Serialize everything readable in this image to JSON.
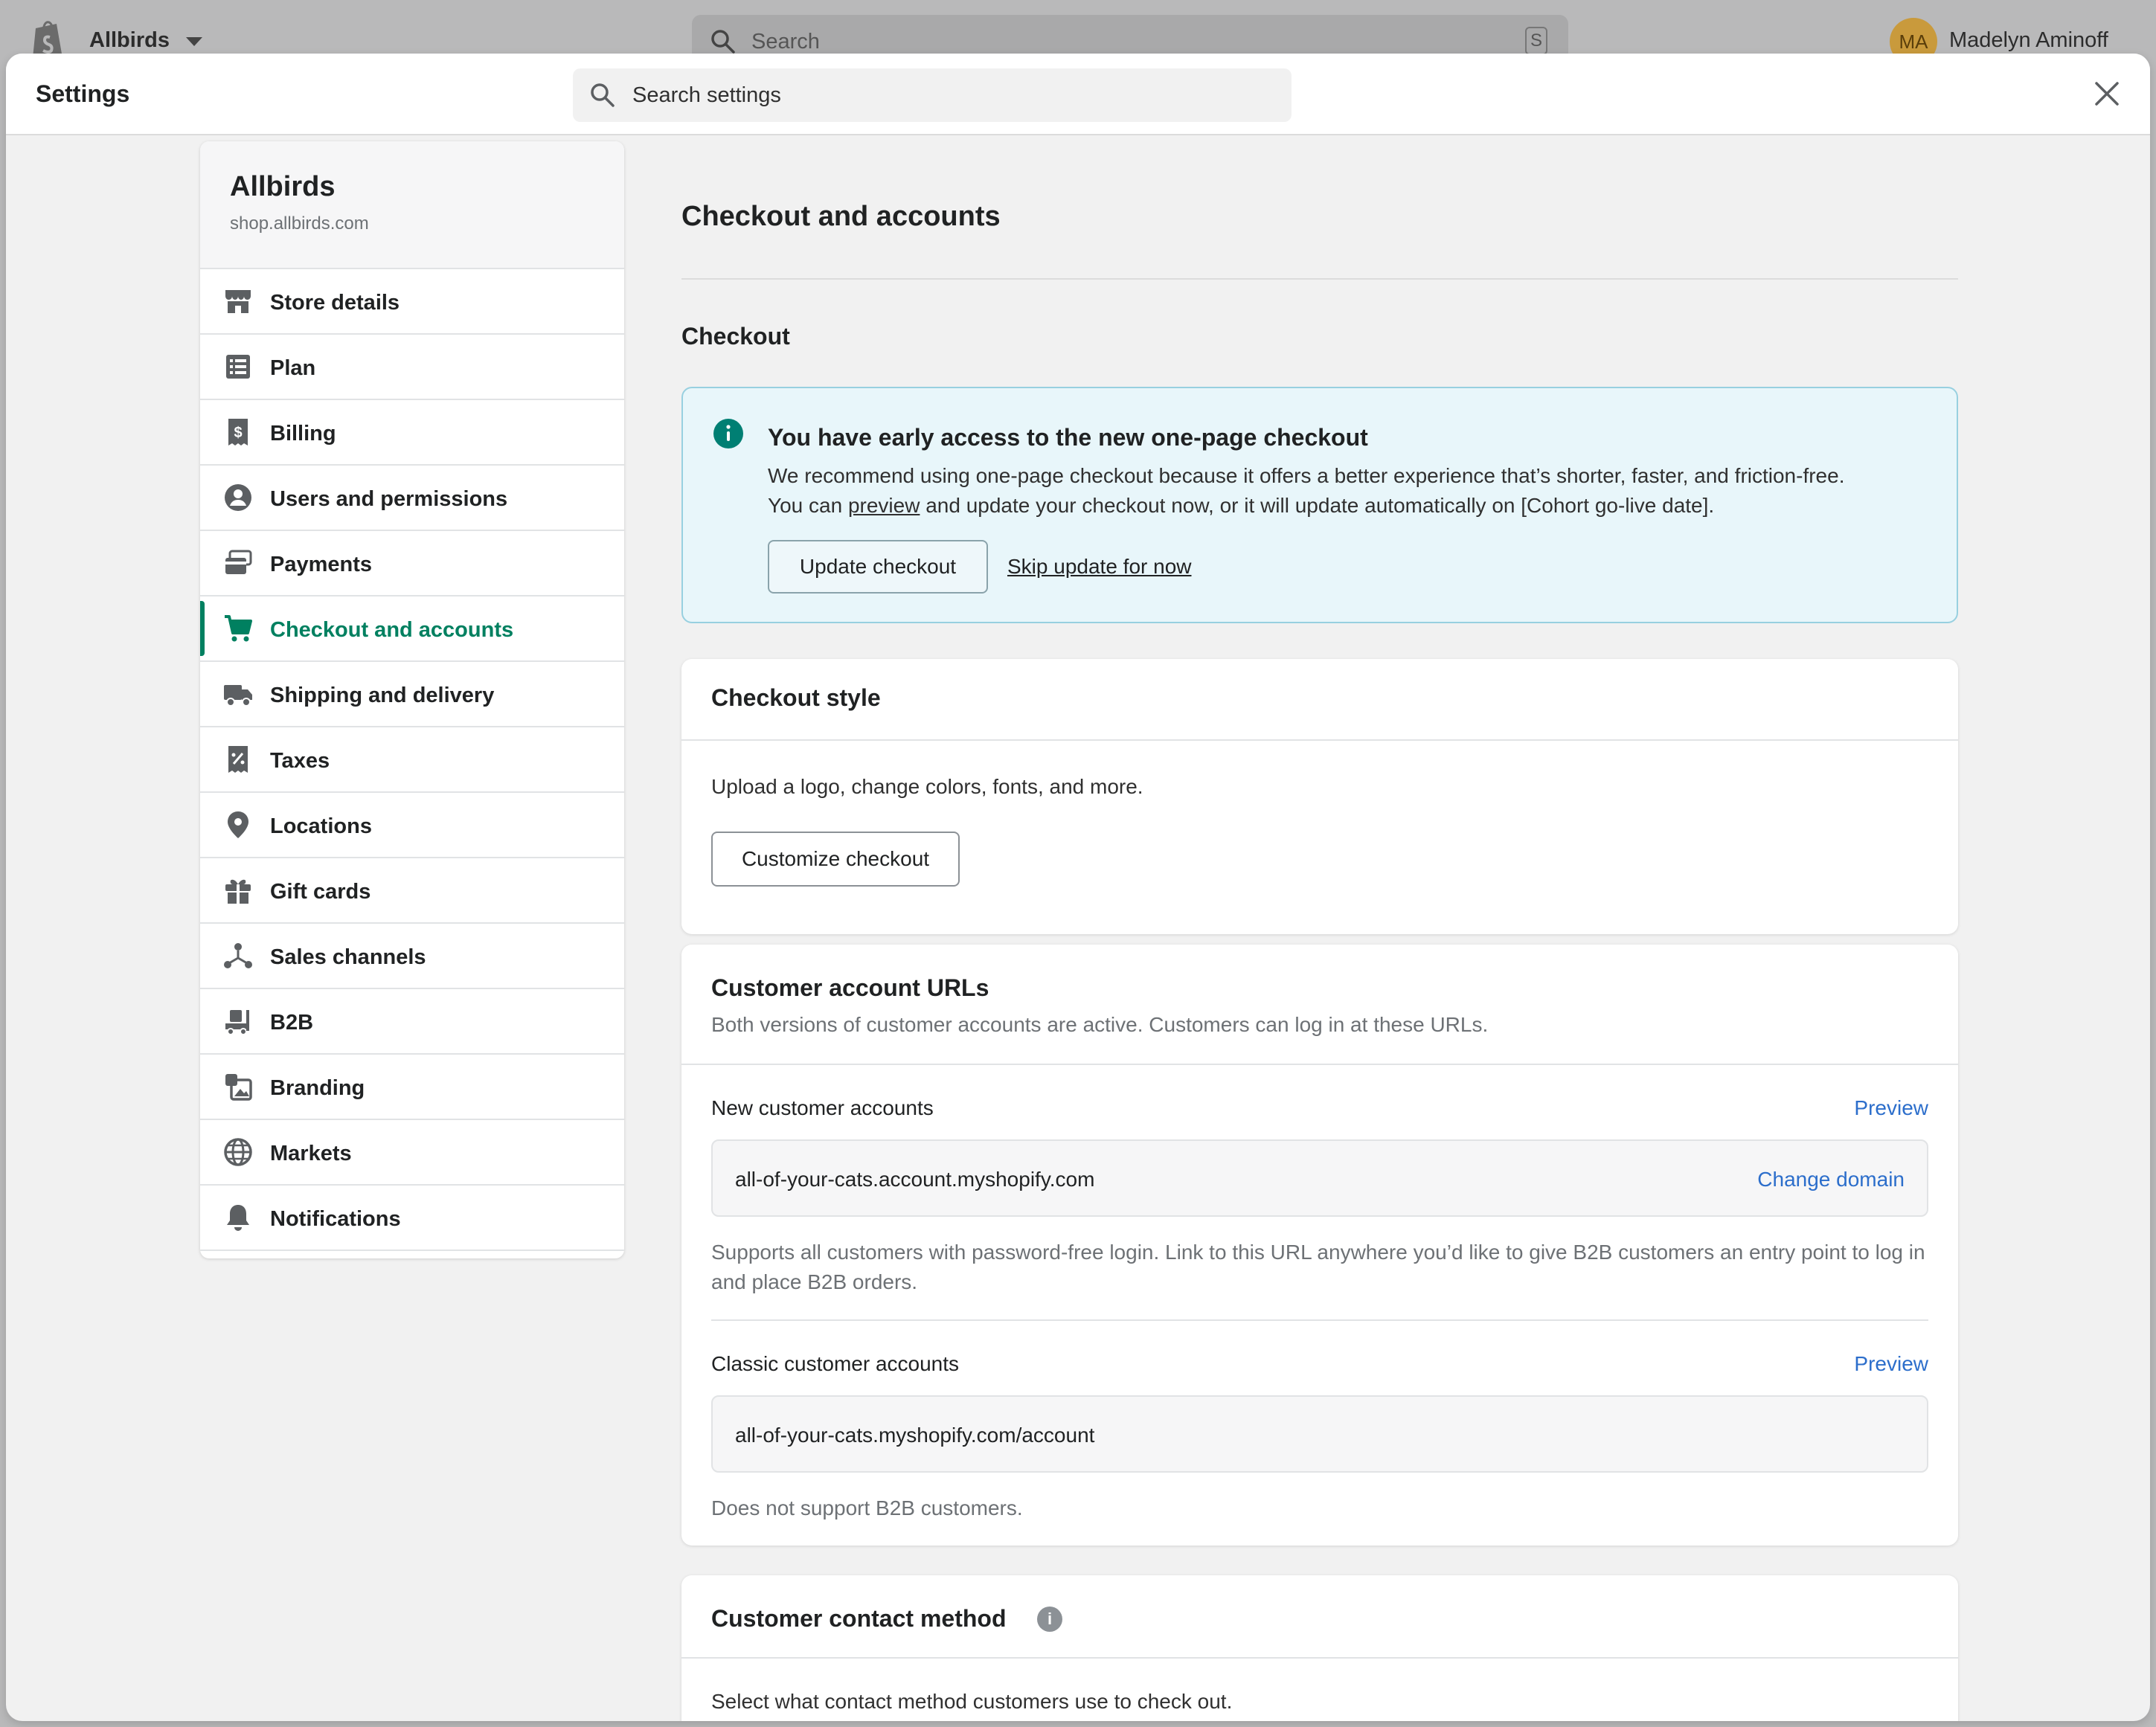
{
  "topbar": {
    "store_name": "Allbirds",
    "search_placeholder": "Search",
    "search_shortcut": "S",
    "avatar_initials": "MA",
    "user_name": "Madelyn Aminoff"
  },
  "modal": {
    "title": "Settings",
    "search_placeholder": "Search settings"
  },
  "sidebar": {
    "store_name": "Allbirds",
    "store_url": "shop.allbirds.com",
    "items": [
      {
        "label": "Store details",
        "icon": "store-icon"
      },
      {
        "label": "Plan",
        "icon": "plan-icon"
      },
      {
        "label": "Billing",
        "icon": "billing-icon"
      },
      {
        "label": "Users and permissions",
        "icon": "user-icon"
      },
      {
        "label": "Payments",
        "icon": "payments-icon"
      },
      {
        "label": "Checkout and accounts",
        "icon": "cart-icon",
        "active": true
      },
      {
        "label": "Shipping and delivery",
        "icon": "truck-icon"
      },
      {
        "label": "Taxes",
        "icon": "taxes-icon"
      },
      {
        "label": "Locations",
        "icon": "location-icon"
      },
      {
        "label": "Gift cards",
        "icon": "gift-icon"
      },
      {
        "label": "Sales channels",
        "icon": "channels-icon"
      },
      {
        "label": "B2B",
        "icon": "b2b-icon"
      },
      {
        "label": "Branding",
        "icon": "branding-icon"
      },
      {
        "label": "Markets",
        "icon": "globe-icon"
      },
      {
        "label": "Notifications",
        "icon": "bell-icon"
      }
    ]
  },
  "main": {
    "page_title": "Checkout and accounts",
    "section_title": "Checkout",
    "banner": {
      "title": "You have early access to the new one-page checkout",
      "body_1": "We recommend using one-page checkout because it offers a better experience that’s shorter, faster, and friction-free.",
      "body_2a": "You can ",
      "body_2_link": "preview",
      "body_2b": " and update your checkout now, or it will update automatically on [Cohort go-live date].",
      "primary_button": "Update checkout",
      "secondary_link": "Skip update for now"
    },
    "checkout_style": {
      "title": "Checkout style",
      "description": "Upload a logo, change colors, fonts, and more.",
      "button": "Customize checkout"
    },
    "customer_urls": {
      "title": "Customer account URLs",
      "subtitle": "Both versions of customer accounts are active. Customers can log in at these URLs.",
      "new_label": "New customer accounts",
      "new_preview": "Preview",
      "new_url": "all-of-your-cats.account.myshopify.com",
      "new_action": "Change domain",
      "new_help": "Supports all customers with password-free login. Link to this URL anywhere you’d like to give B2B customers an entry point to log in and place B2B orders.",
      "classic_label": "Classic customer accounts",
      "classic_preview": "Preview",
      "classic_url": "all-of-your-cats.myshopify.com/account",
      "classic_help": "Does not support B2B customers."
    },
    "contact_method": {
      "title": "Customer contact method",
      "description": "Select what contact method customers use to check out."
    }
  },
  "colors": {
    "accent": "#008060",
    "link": "#2c6ecb",
    "banner_bg": "#e8f6fa"
  }
}
